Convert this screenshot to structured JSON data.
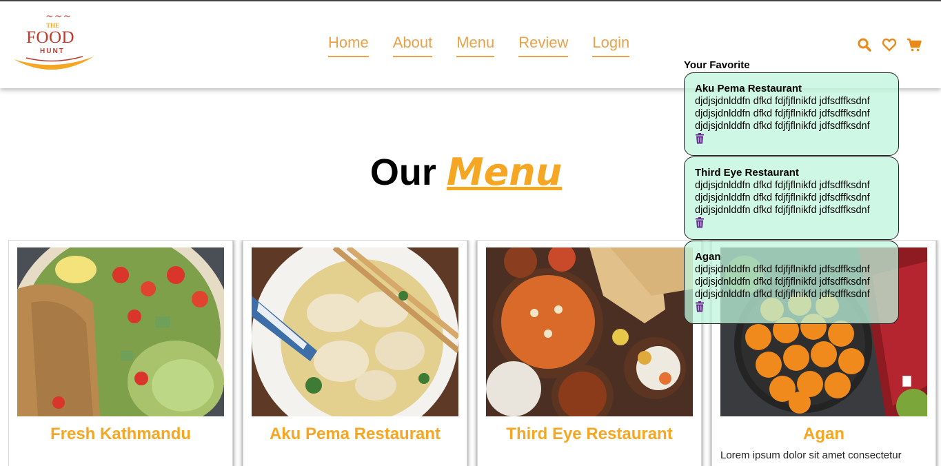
{
  "brand": {
    "top": "THE",
    "name": "FOOD",
    "sub": "HUNT"
  },
  "nav": {
    "items": [
      {
        "label": "Home"
      },
      {
        "label": "About"
      },
      {
        "label": "Menu"
      },
      {
        "label": "Review"
      },
      {
        "label": "Login"
      }
    ]
  },
  "header_icons": [
    "search-icon",
    "heart-icon",
    "cart-icon"
  ],
  "heading": {
    "plain": "Our",
    "accent": "Menu"
  },
  "cards": [
    {
      "title": "Fresh Kathmandu",
      "description": ""
    },
    {
      "title": "Aku Pema Restaurant",
      "description": ""
    },
    {
      "title": "Third Eye Restaurant",
      "description": ""
    },
    {
      "title": "Agan",
      "description": "Lorem ipsum dolor sit amet consectetur"
    }
  ],
  "favorites": {
    "heading": "Your Favorite",
    "items": [
      {
        "title": "Aku Pema Restaurant",
        "text": "djdjsjdnlddfn dfkd fdjfjflnikfd jdfsdffksdnf djdjsjdnlddfn dfkd fdjfjflnikfd jdfsdffksdnf djdjsjdnlddfn dfkd fdjfjflnikfd jdfsdffksdnf"
      },
      {
        "title": "Third Eye Restaurant",
        "text": "djdjsjdnlddfn dfkd fdjfjflnikfd jdfsdffksdnf djdjsjdnlddfn dfkd fdjfjflnikfd jdfsdffksdnf djdjsjdnlddfn dfkd fdjfjflnikfd jdfsdffksdnf"
      },
      {
        "title": "Agan",
        "text": "djdjsjdnlddfn dfkd fdjfjflnikfd jdfsdffksdnf djdjsjdnlddfn dfkd fdjfjflnikfd jdfsdffksdnf djdjsjdnlddfn dfkd fdjfjflnikfd jdfsdffksdnf"
      }
    ]
  },
  "colors": {
    "accent": "#f5a623",
    "nav_link": "#e8a24a",
    "brand_red": "#c0392b",
    "favorite_bg": "#c8f5e0",
    "trash": "#6a2c91"
  }
}
